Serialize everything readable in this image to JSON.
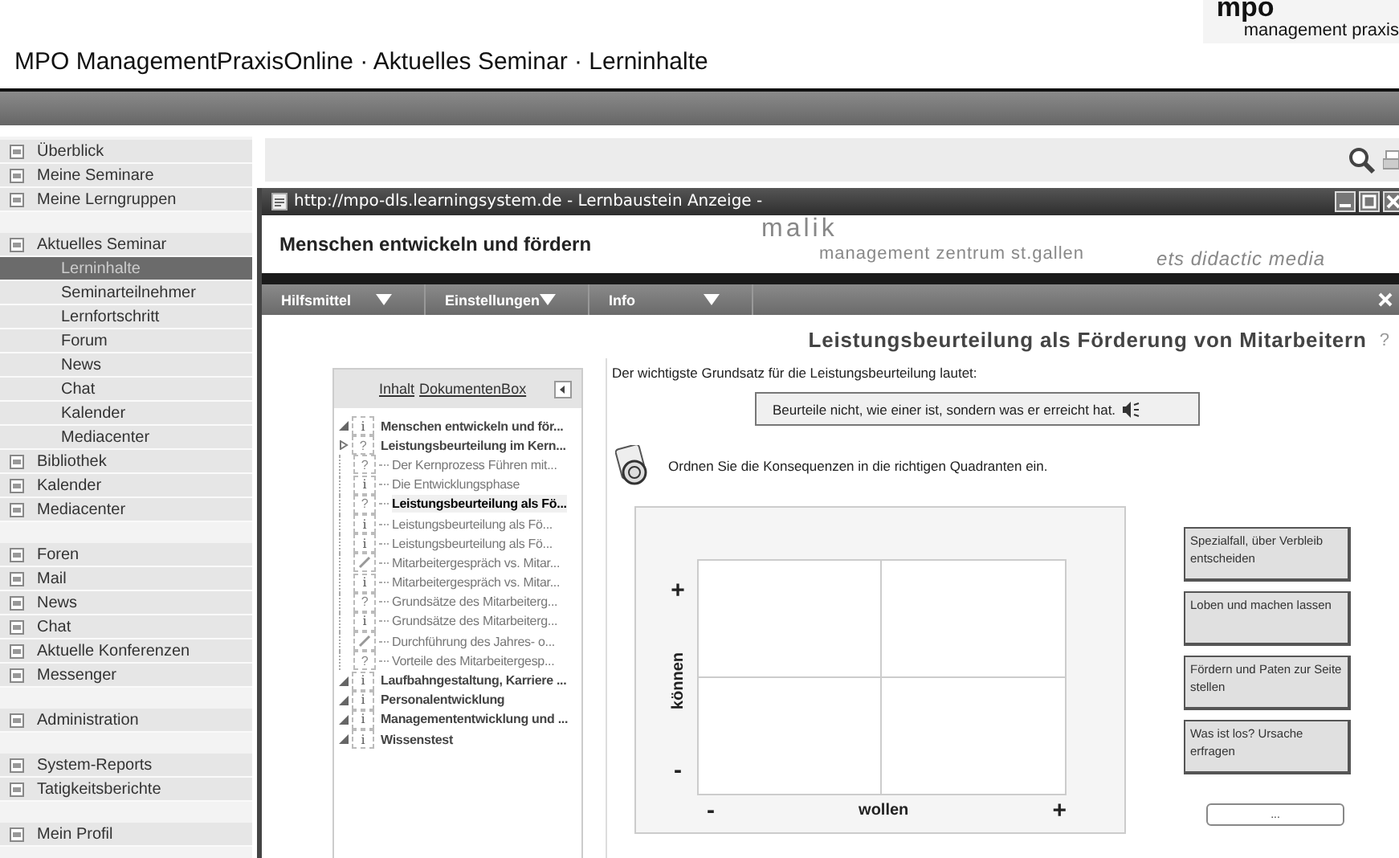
{
  "header": {
    "title": "MPO ManagementPraxisOnline · Aktuelles Seminar · Lerninhalte",
    "logo_name": "mpo",
    "logo_tagline": "management praxis"
  },
  "sidebar": {
    "groups": [
      [
        {
          "label": "Überblick",
          "selected": false
        },
        {
          "label": "Meine Seminare",
          "selected": false
        },
        {
          "label": "Meine Lerngruppen",
          "selected": false
        }
      ],
      [
        {
          "label": "Aktuelles Seminar",
          "selected": false,
          "children": [
            {
              "label": "Lerninhalte",
              "selected": true
            },
            {
              "label": "Seminarteilnehmer",
              "selected": false
            },
            {
              "label": "Lernfortschritt",
              "selected": false
            },
            {
              "label": "Forum",
              "selected": false
            },
            {
              "label": "News",
              "selected": false
            },
            {
              "label": "Chat",
              "selected": false
            },
            {
              "label": "Kalender",
              "selected": false
            },
            {
              "label": "Mediacenter",
              "selected": false
            }
          ]
        },
        {
          "label": "Bibliothek",
          "selected": false
        },
        {
          "label": "Kalender",
          "selected": false
        },
        {
          "label": "Mediacenter",
          "selected": false
        }
      ],
      [
        {
          "label": "Foren",
          "selected": false
        },
        {
          "label": "Mail",
          "selected": false
        },
        {
          "label": "News",
          "selected": false
        },
        {
          "label": "Chat",
          "selected": false
        },
        {
          "label": "Aktuelle Konferenzen",
          "selected": false
        },
        {
          "label": "Messenger",
          "selected": false
        }
      ],
      [
        {
          "label": "Administration",
          "selected": false
        }
      ],
      [
        {
          "label": "System-Reports",
          "selected": false
        },
        {
          "label": "Tatigkeitsberichte",
          "selected": false
        }
      ],
      [
        {
          "label": "Mein Profil",
          "selected": false
        }
      ]
    ]
  },
  "popup": {
    "title": "http://mpo-dls.learningsystem.de - Lernbaustein Anzeige -",
    "heading": "Menschen entwickeln und fördern",
    "partner_logo": {
      "name": "malik",
      "tagline": "management zentrum st.gallen"
    },
    "vendor_logo": "ets didactic media",
    "menus": [
      {
        "label": "Hilfsmittel"
      },
      {
        "label": "Einstellungen"
      },
      {
        "label": "Info"
      }
    ],
    "page_title": "Leistungsbeurteilung als Förderung von Mitarbeitern",
    "help": "?",
    "panel": {
      "tabs": [
        {
          "label": "Inhalt"
        },
        {
          "label": "DokumentenBox"
        }
      ],
      "tree": [
        {
          "label": "Menschen entwickeln und för...",
          "kind": "info",
          "icon": "i",
          "expanded": true,
          "selected": false
        },
        {
          "label": "Leistungsbeurteilung im Kern...",
          "kind": "question",
          "icon": "?",
          "expanded": false,
          "selected": false,
          "children": [
            {
              "label": "Der Kernprozess Führen mit...",
              "kind": "question",
              "icon": "?",
              "selected": false
            },
            {
              "label": "Die Entwicklungsphase",
              "kind": "info",
              "icon": "i",
              "selected": false
            },
            {
              "label": "Leistungsbeurteilung als Fö...",
              "kind": "question",
              "icon": "?",
              "selected": true
            },
            {
              "label": "Leistungsbeurteilung als Fö...",
              "kind": "info",
              "icon": "i",
              "selected": false
            },
            {
              "label": "Leistungsbeurteilung als Fö...",
              "kind": "info",
              "icon": "i",
              "selected": false
            },
            {
              "label": "Mitarbeitergespräch vs. Mitar...",
              "kind": "edit",
              "selected": false
            },
            {
              "label": "Mitarbeitergespräch vs. Mitar...",
              "kind": "info",
              "icon": "i",
              "selected": false
            },
            {
              "label": "Grundsätze des Mitarbeiterg...",
              "kind": "question",
              "icon": "?",
              "selected": false
            },
            {
              "label": "Grundsätze des Mitarbeiterg...",
              "kind": "info",
              "icon": "i",
              "selected": false
            },
            {
              "label": "Durchführung des Jahres- o...",
              "kind": "edit",
              "selected": false
            },
            {
              "label": "Vorteile des Mitarbeitergesp...",
              "kind": "question",
              "icon": "?",
              "selected": false
            }
          ]
        },
        {
          "label": "Laufbahngestaltung, Karriere ...",
          "kind": "info",
          "icon": "i",
          "expanded": true,
          "selected": false
        },
        {
          "label": "Personalentwicklung",
          "kind": "info",
          "icon": "i",
          "expanded": true,
          "selected": false
        },
        {
          "label": "Managemententwicklung und ...",
          "kind": "info",
          "icon": "i",
          "expanded": true,
          "selected": false
        },
        {
          "label": "Wissenstest",
          "kind": "info",
          "icon": "i",
          "expanded": true,
          "selected": false
        }
      ]
    },
    "intro": "Der wichtigste Grundsatz für die Leistungsbeurteilung lautet:",
    "quote": "Beurteile nicht, wie einer ist, sondern was er erreicht hat.",
    "instruction": "Ordnen Sie die Konsequenzen in die richtigen Quadranten ein.",
    "board": {
      "y_plus": "+",
      "y_axis": "können",
      "y_minus": "-",
      "x_minus": "-",
      "x_axis": "wollen",
      "x_plus": "+"
    },
    "cards": [
      "Spezialfall, über Verbleib entscheiden",
      "Loben und machen lassen",
      "Fördern und Paten zur Seite stellen",
      "Was ist los? Ursache erfragen"
    ],
    "more_button": "..."
  }
}
